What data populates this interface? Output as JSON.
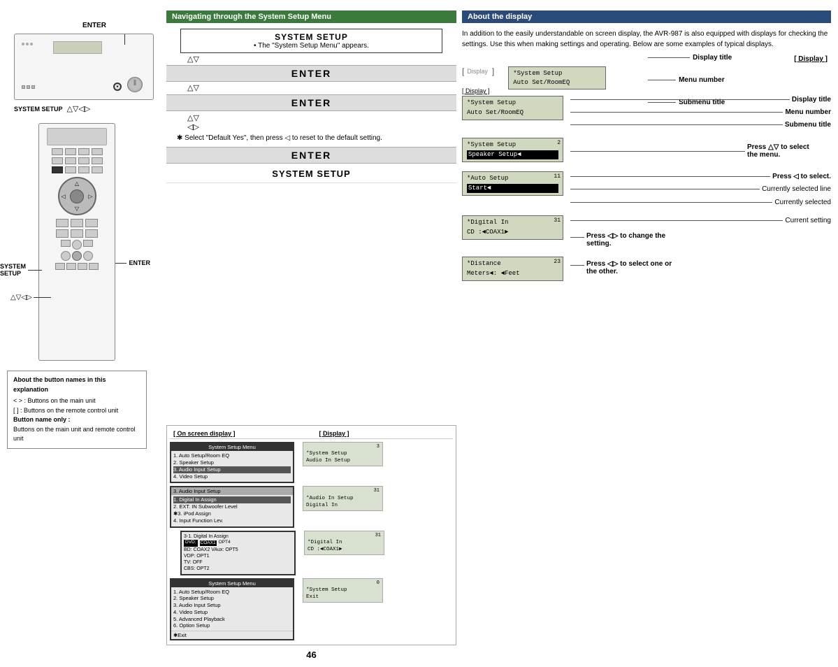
{
  "page": {
    "number": "46"
  },
  "left": {
    "enter_label": "ENTER",
    "system_setup_label": "SYSTEM SETUP",
    "arrows1": "△▽◁▷",
    "enter_label2": "ENTER",
    "arrows2": "△▽◁▷",
    "bottom_note": {
      "title": "About the button names in this explanation",
      "line1": "< >  : Buttons on the main unit",
      "line2": "[ ]  : Buttons on the remote control unit",
      "bold_line": "Button name only :",
      "line3": "  Buttons on the main unit and remote control unit"
    }
  },
  "middle": {
    "section_title": "Navigating through the System Setup Menu",
    "step1": {
      "label": "SYSTEM SETUP",
      "desc": "• The \"System Setup Menu\" appears."
    },
    "step2_arrows": "△▽",
    "step2_enter": "ENTER",
    "step3_arrows": "△▽",
    "step3_enter": "ENTER",
    "step4_arrows": "△▽",
    "step4_arrows2": "◁▷",
    "step4_note": "✱ Select \"Default Yes\", then press ◁ to reset to the default setting.",
    "step5_enter": "ENTER",
    "step6": "SYSTEM SETUP",
    "displays_section": {
      "header_left": "[ On screen display ]",
      "header_right": "[ Display ]",
      "row1_onscreen_title": "System Setup Menu",
      "row1_onscreen_content": "1. Auto Setup/Room EQ\n2. Speaker Setup\n3. Audio Input Setup\n4. Video Setup",
      "row1_lcd": "*System Setup\nAudio In Setup",
      "row1_lcd_num": "3",
      "row2_onscreen_title": "3. Audio Input Setup",
      "row2_onscreen_content": "1. Digital In Assign\n2. EXT. IN Subwoofer Level\n3. iPod Assign\n4. Input Function Lev.",
      "row2_lcd": "*Audio In Setup\nDigital In",
      "row2_lcd_num": "31",
      "row3_onscreen": "3-1. Digital In Assign\nDVD: COAX1  OPT4\nBD:  COAX2  VAux: OPT5\nVDP: OPT1\nTV:  OFF\nCBS: OPT2",
      "row3_highlight": "DVD: COAX1",
      "row3_lcd": "*Digital In\nCD    :◄COAX1►",
      "row3_lcd_num": "31",
      "row4_onscreen_title": "System Setup Menu",
      "row4_onscreen_content": "1. Auto Setup/Room EQ\n2. Speaker Setup\n3. Audio Input Setup\n4. Video Setup\n5. Advanced Playback\n6. Option Setup",
      "row4_onscreen_footer": "✱Exit",
      "row4_lcd": "*System Setup\nExit",
      "row4_lcd_num": "0"
    }
  },
  "right": {
    "section_title": "About the display",
    "description": "In addition to the easily understandable on screen display, the AVR-987 is also equipped with displays for checking the settings. Use this when making settings and operating. Below are some examples of typical displays.",
    "display_label": "[ Display ]",
    "examples": [
      {
        "id": "ex1",
        "screen_line1": "*System Setup",
        "screen_line2": "Auto Set/RoomEQ",
        "annotations": [
          {
            "label": "Display title",
            "bold": true
          },
          {
            "label": "Menu number",
            "bold": true
          },
          {
            "label": "Submenu title",
            "bold": true
          }
        ]
      },
      {
        "id": "ex2",
        "screen_num": "2",
        "screen_line1": "*System Setup",
        "screen_line2": "Speaker Setup",
        "annotations": [
          {
            "label": "Press △▽ to select",
            "bold": true
          },
          {
            "label": "the menu.",
            "bold": true
          }
        ]
      },
      {
        "id": "ex3",
        "screen_num": "11",
        "screen_line1": "*Auto Setup",
        "screen_line2": "Start◄",
        "annotations": [
          {
            "label": "Press ◁ to select.",
            "bold": true
          },
          {
            "label": "Currently selected line",
            "bold": false
          }
        ]
      },
      {
        "id": "ex4",
        "screen_num": "31",
        "screen_line1": "*Digital In",
        "screen_line2": "CD    :◄COAX1►",
        "annotations": [
          {
            "label": "Current setting",
            "bold": false
          },
          {
            "label": "Press ◁▷ to change the",
            "bold": true
          },
          {
            "label": "setting.",
            "bold": true
          }
        ]
      },
      {
        "id": "ex5",
        "screen_num": "23",
        "screen_line1": "*Distance",
        "screen_line2": "Meters◄: ◄Feet",
        "annotations": [
          {
            "label": "Press ◁▷ to select one or",
            "bold": true
          },
          {
            "label": "the other.",
            "bold": true
          }
        ]
      }
    ],
    "currently_selected": "Currently selected"
  }
}
